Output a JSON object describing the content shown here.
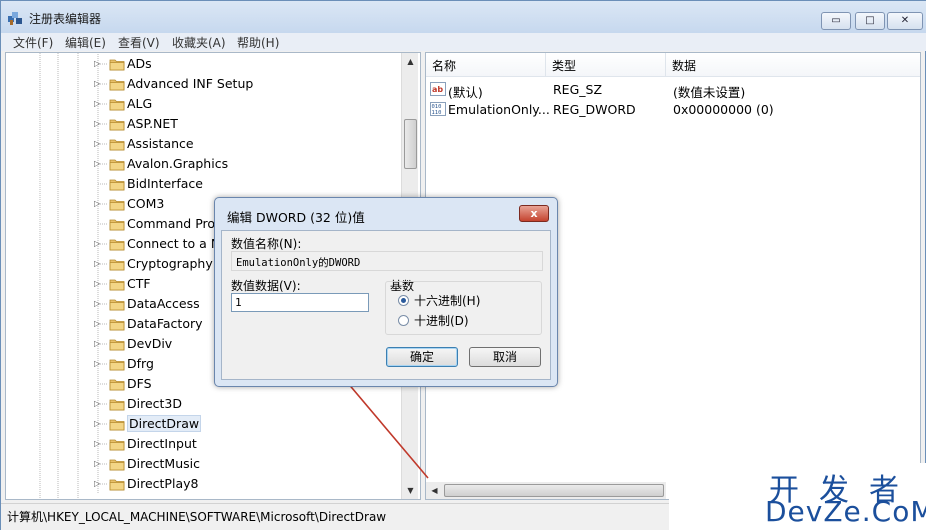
{
  "window": {
    "title": "注册表编辑器",
    "controls": {
      "minimize": "▭",
      "maximize": "□",
      "close": "✕"
    }
  },
  "menu": [
    "文件(F)",
    "编辑(E)",
    "查看(V)",
    "收藏夹(A)",
    "帮助(H)"
  ],
  "tree": {
    "items": [
      {
        "label": "ADs",
        "expandable": true
      },
      {
        "label": "Advanced INF Setup",
        "expandable": true
      },
      {
        "label": "ALG",
        "expandable": true
      },
      {
        "label": "ASP.NET",
        "expandable": true
      },
      {
        "label": "Assistance",
        "expandable": true
      },
      {
        "label": "Avalon.Graphics",
        "expandable": true
      },
      {
        "label": "BidInterface",
        "expandable": false
      },
      {
        "label": "COM3",
        "expandable": true
      },
      {
        "label": "Command Proc",
        "expandable": false
      },
      {
        "label": "Connect to a N",
        "expandable": true
      },
      {
        "label": "Cryptography",
        "expandable": true
      },
      {
        "label": "CTF",
        "expandable": true
      },
      {
        "label": "DataAccess",
        "expandable": true
      },
      {
        "label": "DataFactory",
        "expandable": true
      },
      {
        "label": "DevDiv",
        "expandable": true
      },
      {
        "label": "Dfrg",
        "expandable": true
      },
      {
        "label": "DFS",
        "expandable": false
      },
      {
        "label": "Direct3D",
        "expandable": true
      },
      {
        "label": "DirectDraw",
        "expandable": true,
        "selected": true
      },
      {
        "label": "DirectInput",
        "expandable": true
      },
      {
        "label": "DirectMusic",
        "expandable": true
      },
      {
        "label": "DirectPlay8",
        "expandable": true
      }
    ]
  },
  "list": {
    "headers": {
      "name": "名称",
      "type": "类型",
      "data": "数据"
    },
    "rows": [
      {
        "icon": "string-value-icon",
        "name": "(默认)",
        "type": "REG_SZ",
        "data": "(数值未设置)"
      },
      {
        "icon": "dword-value-icon",
        "name": "EmulationOnly...",
        "type": "REG_DWORD",
        "data": "0x00000000 (0)"
      }
    ]
  },
  "status": {
    "path": "计算机\\HKEY_LOCAL_MACHINE\\SOFTWARE\\Microsoft\\DirectDraw"
  },
  "dialog": {
    "title": "编辑 DWORD (32 位)值",
    "close": "x",
    "name_label": "数值名称(N):",
    "name_value": "EmulationOnly的DWORD",
    "data_label": "数值数据(V):",
    "data_value": "1",
    "base_label": "基数",
    "hex_label": "十六进制(H)",
    "dec_label": "十进制(D)",
    "base_selected": "hex",
    "ok": "确定",
    "cancel": "取消"
  },
  "watermark": {
    "top": "开发者",
    "bottom": "DevZe.CoM"
  },
  "colors": {
    "accent": "#1b4f9c",
    "annotation_arrow": "#c0392b",
    "selection": "#e3ecf7"
  }
}
